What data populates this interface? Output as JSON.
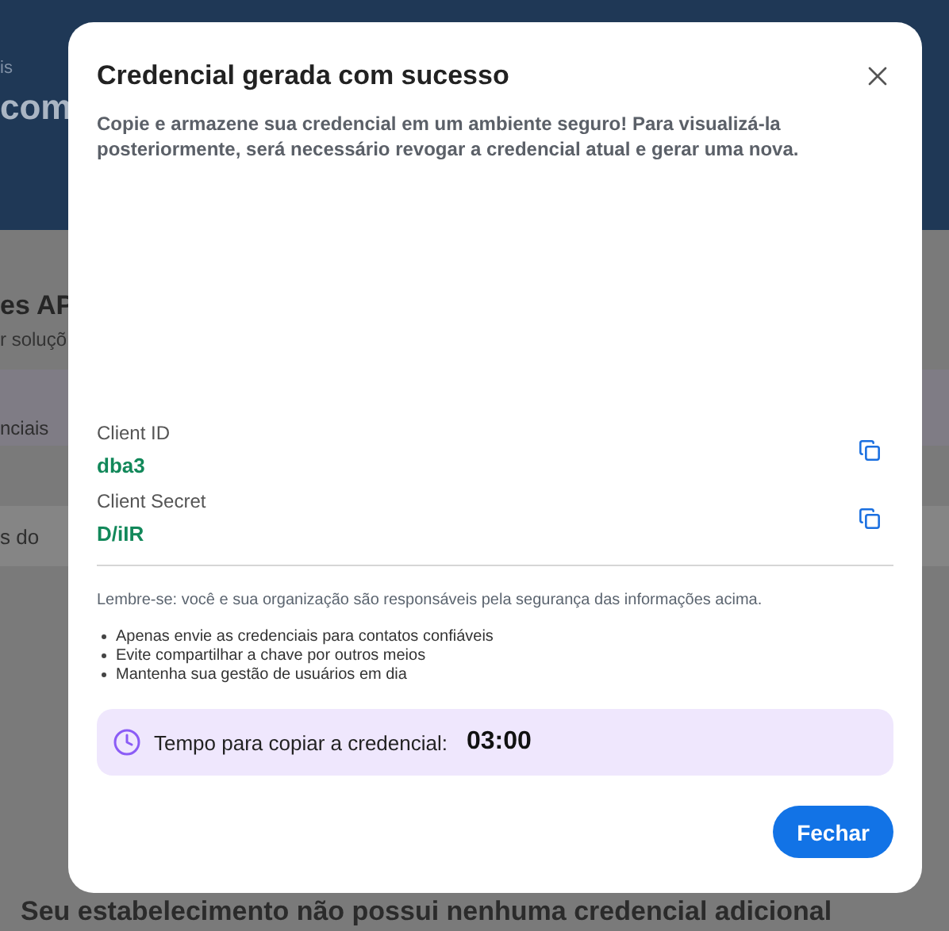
{
  "background": {
    "header_texts": [
      "is",
      "com"
    ],
    "section_title": "es AP",
    "section_subtitle": "r soluçõ",
    "banner_text": "nciais",
    "tab_text": "s do",
    "footer_text": "Seu estabelecimento não possui nenhuma credencial adicional"
  },
  "dialog": {
    "title": "Credencial gerada com sucesso",
    "description": "Copie e armazene sua credencial em um ambiente seguro! Para visualizá-la posteriormente, será necessário revogar a credencial atual e gerar uma nova.",
    "credentials": [
      {
        "label": "Client ID",
        "value": "dba3"
      },
      {
        "label": "Client Secret",
        "value": "D/iIR"
      }
    ],
    "reminder": "Lembre-se: você e sua organização são responsáveis pela segurança das informações acima.",
    "tips": [
      "Apenas envie as credenciais para contatos confiáveis",
      "Evite compartilhar a chave por outros meios",
      "Mantenha sua gestão de usuários em dia"
    ],
    "timer": {
      "label": "Tempo para copiar a credencial:",
      "value": "03:00"
    },
    "close_button": "Fechar"
  }
}
